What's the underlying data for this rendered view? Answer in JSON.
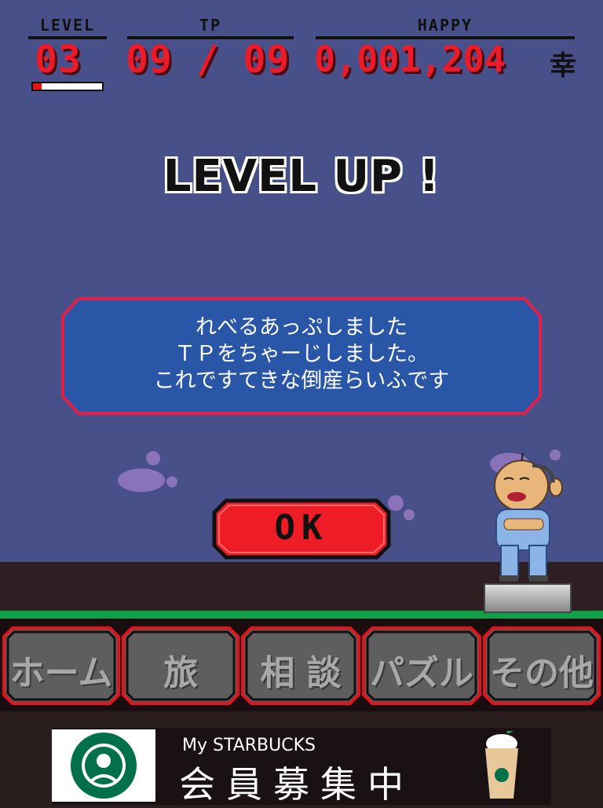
{
  "hud": {
    "level_label": "LEVEL",
    "level_value": "03",
    "level_progress": 0.12,
    "tp_label": "TP",
    "tp_value": "09 / 09",
    "happy_label": "HAPPY",
    "happy_value": "0,001,204",
    "happy_unit": "幸"
  },
  "banner": {
    "title": "LEVEL UP !"
  },
  "message": {
    "line1": "れべるあっぷしました",
    "line2": "ＴＰをちゃーじしました。",
    "line3": "これですてきな倒産らいふです"
  },
  "ok_button": {
    "label": "OK"
  },
  "nav": {
    "items": [
      {
        "label": "ホーム"
      },
      {
        "label": "旅"
      },
      {
        "label": "相 談"
      },
      {
        "label": "パズル"
      },
      {
        "label": "その他"
      }
    ]
  },
  "ad": {
    "small": "My STARBUCKS",
    "main": "会員募集中"
  },
  "colors": {
    "sky": "#48508a",
    "hud_red": "#ec1b2a",
    "message_fill": "#2a56a8",
    "message_border": "#e0204a",
    "ok_red": "#ee1c24",
    "nav_button": "#5e5e5e",
    "nav_border": "#e0141e"
  }
}
